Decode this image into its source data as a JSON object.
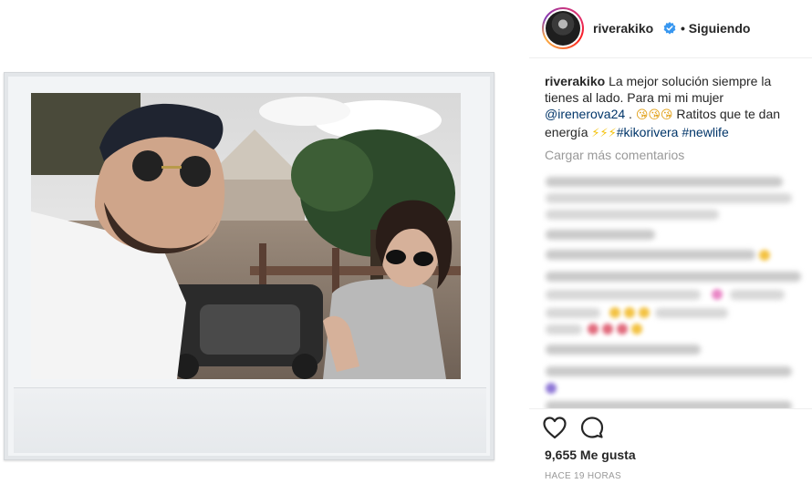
{
  "post": {
    "author": "riverakiko",
    "follow_status": "• Siguiendo",
    "caption": {
      "user": "riverakiko",
      "text_1": "La mejor solución siempre la tienes al lado. Para mi mi mujer",
      "mention": "@irenerova24",
      "text_2": " . ",
      "emojis_1": "😘😘😘",
      "text_3": " Ratitos que te dan energía ",
      "emojis_2": "⚡⚡⚡",
      "hashtag_1": "#kikorivera",
      "hashtag_2": "#newlife"
    },
    "load_more": "Cargar más comentarios",
    "likes": "9,655 Me gusta",
    "time": "HACE 19 HORAS"
  },
  "icons": {
    "verified": "verified-badge-icon",
    "like": "heart-icon",
    "comment": "comment-bubble-icon"
  },
  "colors": {
    "text": "#262626",
    "muted": "#999999",
    "link": "#003569",
    "verified": "#3897f0"
  }
}
